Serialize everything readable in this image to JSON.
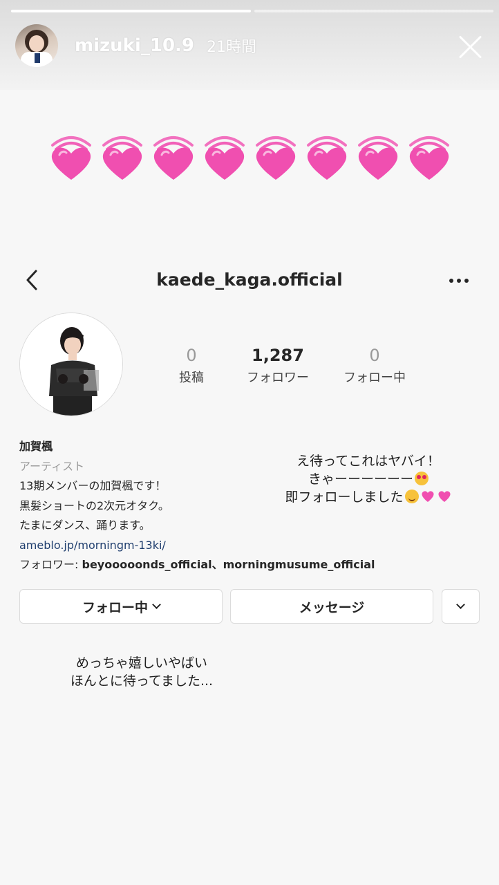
{
  "story": {
    "username": "mizuki_10.9",
    "time": "21時間",
    "progress": [
      1.0,
      0.0
    ]
  },
  "hearts": {
    "icon": "growing-heart-icon",
    "count": 8,
    "color": "#f04fb0"
  },
  "profile": {
    "username": "kaede_kaga.official",
    "stats": {
      "posts": {
        "value": "0",
        "label": "投稿"
      },
      "followers": {
        "value": "1,287",
        "label": "フォロワー"
      },
      "following": {
        "value": "0",
        "label": "フォロー中"
      }
    },
    "bio": {
      "name": "加賀楓",
      "category": "アーティスト",
      "line1": "13期メンバーの加賀楓です！",
      "line2": "黒髪ショートの2次元オタク。",
      "line3": "たまにダンス、踊ります。",
      "link": "ameblo.jp/morningm-13ki/",
      "followed_by_prefix": "フォロワー: ",
      "followed_by_names": "beyooooonds_official、morningmusume_official"
    },
    "buttons": {
      "following": "フォロー中",
      "message": "メッセージ"
    }
  },
  "overlay_text": {
    "line1": "え待ってこれはヤバイ！",
    "line2": "きゃーーーーーー",
    "line3": "即フォローしました",
    "line4": "めっちゃ嬉しいやばい",
    "line5": "ほんとに待ってました..."
  }
}
